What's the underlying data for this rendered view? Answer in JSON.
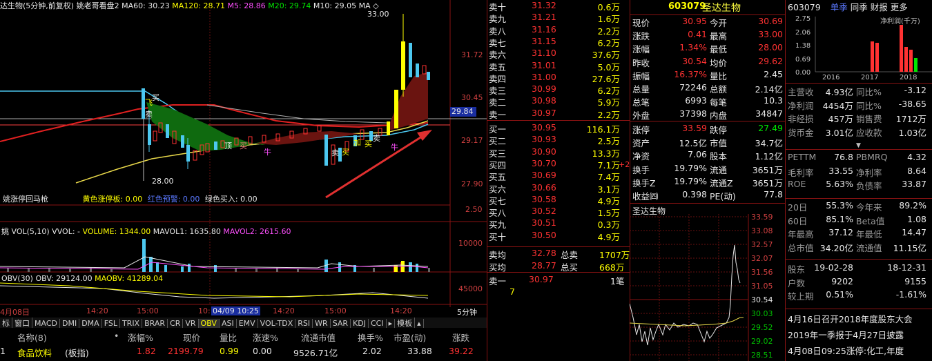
{
  "chart_header": {
    "title": "达生物(5分钟,前复权)",
    "ind_name": "姚老哥看盘2",
    "ma60": "MA60: 30.23",
    "ma120": "MA120: 28.71",
    "m5": "M5: 28.86",
    "m20": "M20: 29.74",
    "m10": "M10: 29.05",
    "ma_cut": "MA",
    "diamond": "◇"
  },
  "price_axis": [
    "31.72",
    "30.45",
    "29.17",
    "27.90",
    "2.50"
  ],
  "current_price_tag": "29.84",
  "annotations": {
    "high": "33.00",
    "low": "28.00",
    "b1": "买",
    "b2": "卖",
    "b3": "顶",
    "b4": "卖",
    "b5": "卖",
    "niu": "牛",
    "niu2": "牛",
    "fei": "飞",
    "jia": "加",
    "buy_r": "买",
    "buy_y": "买",
    "buy_y2": "买"
  },
  "signal_bar": {
    "name": "姚涨停回马枪",
    "yellow": "黄色涨停板: 0.00",
    "red": "红色预警: 0.00",
    "green": "绿色买入: 0.00"
  },
  "vol_header": {
    "name": "姚 VOL(5,10) VVOL: -",
    "volume": "VOLUME: 1344.00",
    "mavol1": "MAVOL1: 1635.80",
    "mavol2": "MAVOL2: 2615.60",
    "axis": "10000"
  },
  "obv_header": {
    "name": "OBV(30)",
    "obv": "OBV: 29124.00",
    "maobv": "MAOBV: 41289.04",
    "axis": "45000"
  },
  "time_axis": {
    "t0": "4月08日",
    "t1": "14:20",
    "t2": "15:00",
    "t3": "10:10",
    "t4": "04/09 10:25",
    "t5": "14:20",
    "t6": "15:00",
    "t7": "14:20",
    "period": "5分钟"
  },
  "indicator_tabs": [
    "标",
    "窗口",
    "MACD",
    "DMI",
    "DMA",
    "FSL",
    "TRIX",
    "BRAR",
    "CR",
    "VR",
    "OBV",
    "ASI",
    "EMV",
    "VOL-TDX",
    "RSI",
    "WR",
    "SAR",
    "KDJ",
    "CCI",
    "▸",
    "模板",
    "▴"
  ],
  "active_tab": "OBV",
  "sector_table": {
    "headers": [
      "名称(8)",
      "•",
      "涨幅%",
      "现价",
      "量比",
      "涨速%",
      "流通市值",
      "换手%",
      "市盈(动)",
      "涨跌"
    ],
    "row": {
      "idx": "1",
      "name": "食品饮料",
      "tag": "(板指)",
      "chg_pct": "1.82",
      "price": "2199.79",
      "vol_ratio": "0.99",
      "speed": "0.00",
      "mcap": "9526.71亿",
      "turnover": "2.02",
      "pe": "33.88",
      "chg": "39.22"
    }
  },
  "order_book": {
    "asks": [
      {
        "label": "卖十",
        "price": "31.32",
        "vol": "0.6万"
      },
      {
        "label": "卖九",
        "price": "31.21",
        "vol": "1.6万"
      },
      {
        "label": "卖八",
        "price": "31.16",
        "vol": "2.2万"
      },
      {
        "label": "卖七",
        "price": "31.15",
        "vol": "6.2万"
      },
      {
        "label": "卖六",
        "price": "31.10",
        "vol": "37.6万"
      },
      {
        "label": "卖五",
        "price": "31.01",
        "vol": "5.0万"
      },
      {
        "label": "卖四",
        "price": "31.00",
        "vol": "27.6万"
      },
      {
        "label": "卖三",
        "price": "30.99",
        "vol": "6.2万"
      },
      {
        "label": "卖二",
        "price": "30.98",
        "vol": "5.9万"
      },
      {
        "label": "卖一",
        "price": "30.97",
        "vol": "2.2万"
      }
    ],
    "bids": [
      {
        "label": "买一",
        "price": "30.95",
        "vol": "116.1万"
      },
      {
        "label": "买二",
        "price": "30.93",
        "vol": "2.5万"
      },
      {
        "label": "买三",
        "price": "30.90",
        "vol": "13.3万"
      },
      {
        "label": "买四",
        "price": "30.70",
        "vol": "7.1万"
      },
      {
        "label": "买五",
        "price": "30.69",
        "vol": "7.4万"
      },
      {
        "label": "买六",
        "price": "30.66",
        "vol": "3.1万"
      },
      {
        "label": "买七",
        "price": "30.58",
        "vol": "4.9万"
      },
      {
        "label": "买八",
        "price": "30.52",
        "vol": "1.5万"
      },
      {
        "label": "买九",
        "price": "30.51",
        "vol": "0.3万"
      },
      {
        "label": "买十",
        "price": "30.50",
        "vol": "4.9万"
      }
    ],
    "plus2": "+2",
    "avg_ask_label": "卖均",
    "avg_ask": "32.78",
    "total_ask_label": "总卖",
    "total_ask": "1707万",
    "avg_bid_label": "买均",
    "avg_bid": "28.77",
    "total_bid_label": "总买",
    "total_bid": "668万",
    "tick_label": "卖一",
    "tick_price": "30.97",
    "tick_count": "1笔",
    "tick_mark": "7"
  },
  "quote": {
    "code": "603079",
    "name": "圣达生物",
    "rows": [
      {
        "l1": "现价",
        "v1": "30.95",
        "l2": "今开",
        "v2": "30.69"
      },
      {
        "l1": "涨跌",
        "v1": "0.41",
        "l2": "最高",
        "v2": "33.00"
      },
      {
        "l1": "涨幅",
        "v1": "1.34%",
        "l2": "最低",
        "v2": "28.00"
      },
      {
        "l1": "昨收",
        "v1": "30.54",
        "l2": "均价",
        "v2": "29.62"
      },
      {
        "l1": "振幅",
        "v1": "16.37%",
        "l2": "量比",
        "v2": "2.45"
      },
      {
        "l1": "总量",
        "v1": "72246",
        "l2": "总额",
        "v2": "2.14亿"
      },
      {
        "l1": "总笔",
        "v1": "6993",
        "l2": "每笔",
        "v2": "10.3"
      },
      {
        "l1": "外盘",
        "v1": "37398",
        "l2": "内盘",
        "v2": "34847"
      }
    ],
    "rows2": [
      {
        "l1": "涨停",
        "v1": "33.59",
        "l2": "跌停",
        "v2": "27.49"
      },
      {
        "l1": "资产",
        "v1": "12.5亿",
        "l2": "市值",
        "v2": "34.7亿"
      },
      {
        "l1": "净资",
        "v1": "7.06",
        "l2": "股本",
        "v2": "1.12亿"
      },
      {
        "l1": "换手",
        "v1": "19.79%",
        "l2": "流通",
        "v2": "3651万"
      },
      {
        "l1": "换手Z",
        "v1": "19.79%",
        "l2": "流通Z",
        "v2": "3651万"
      },
      {
        "l1": "收益㈣",
        "v1": "0.398",
        "l2": "PE(动)",
        "v2": "77.8"
      }
    ]
  },
  "mini_chart": {
    "title": "圣达生物",
    "axis": [
      "33.59",
      "33.08",
      "32.57",
      "32.07",
      "31.56",
      "31.05",
      "30.54",
      "30.03",
      "29.52",
      "29.02",
      "28.51"
    ]
  },
  "finance": {
    "code": "603079",
    "tabs": [
      "单季",
      "同季",
      "财报",
      "更多"
    ],
    "bar_title": "净利润(千万)",
    "bar_axis": [
      "2.75",
      "2.06",
      "1.38",
      "0.69",
      "0.00"
    ],
    "years": [
      "2016",
      "2017",
      "2018"
    ],
    "rows": [
      {
        "l1": "主营收",
        "v1": "4.93亿",
        "l2": "同比%",
        "v2": "-3.12"
      },
      {
        "l1": "净利润",
        "v1": "4454万",
        "l2": "同比%",
        "v2": "-38.65"
      },
      {
        "l1": "非经损",
        "v1": "457万",
        "l2": "销售费",
        "v2": "1712万"
      },
      {
        "l1": "货币金",
        "v1": "3.01亿",
        "l2": "应收款",
        "v2": "1.03亿"
      }
    ],
    "rows2": [
      {
        "l1": "PETTM",
        "v1": "76.8",
        "l2": "PBMRQ",
        "v2": "4.32"
      },
      {
        "l1": "毛利率",
        "v1": "33.55",
        "l2": "净利率",
        "v2": "8.64"
      },
      {
        "l1": "ROE",
        "v1": "5.63%",
        "l2": "负债率",
        "v2": "33.87"
      }
    ],
    "rows3": [
      {
        "l1": "20日",
        "v1": "55.3%",
        "l2": "今年来",
        "v2": "89.2%"
      },
      {
        "l1": "60日",
        "v1": "85.1%",
        "l2": "Beta值",
        "v2": "1.08"
      },
      {
        "l1": "年最高",
        "v1": "37.12",
        "l2": "年最低",
        "v2": "14.47"
      },
      {
        "l1": "总市值",
        "v1": "34.20亿",
        "l2": "流通值",
        "v2": "11.15亿"
      }
    ],
    "rows4": [
      {
        "l1": "股东",
        "v1": "19-02-28",
        "l2": "",
        "v2": "18-12-31"
      },
      {
        "l1": "户数",
        "v1": "9202",
        "l2": "",
        "v2": "9155"
      },
      {
        "l1": "较上期",
        "v1": "0.51%",
        "l2": "",
        "v2": "-1.61%"
      }
    ],
    "news": [
      "4月16日召开2018年度股东大会",
      "2019年一季报于4月27日披露",
      "4月08日09:25涨停:化工,年度"
    ]
  },
  "colors": {
    "up": "#ff3232",
    "down": "#00e600",
    "accent": "#ffff00",
    "grid": "#8a1212"
  }
}
